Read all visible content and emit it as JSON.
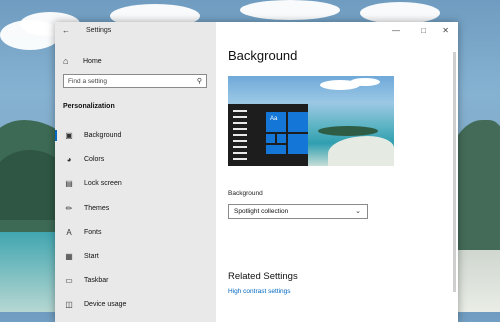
{
  "window": {
    "title": "Settings",
    "back_icon": "back-arrow-icon",
    "minimize_icon": "minimize-icon",
    "maximize_icon": "maximize-icon",
    "close_icon": "close-icon"
  },
  "sidebar": {
    "home": {
      "label": "Home",
      "icon": "home-icon"
    },
    "search": {
      "placeholder": "Find a setting",
      "icon": "search-icon"
    },
    "section_title": "Personalization",
    "items": [
      {
        "label": "Background",
        "icon": "picture-icon",
        "active": true
      },
      {
        "label": "Colors",
        "icon": "palette-icon",
        "active": false
      },
      {
        "label": "Lock screen",
        "icon": "lock-screen-icon",
        "active": false
      },
      {
        "label": "Themes",
        "icon": "brush-icon",
        "active": false
      },
      {
        "label": "Fonts",
        "icon": "fonts-icon",
        "active": false
      },
      {
        "label": "Start",
        "icon": "start-icon",
        "active": false
      },
      {
        "label": "Taskbar",
        "icon": "taskbar-icon",
        "active": false
      },
      {
        "label": "Device usage",
        "icon": "device-usage-icon",
        "active": false
      }
    ]
  },
  "main": {
    "title": "Background",
    "preview": {
      "tile_text": "Aa"
    },
    "background_label": "Background",
    "background_value": "Spotlight collection",
    "related_title": "Related Settings",
    "related_link": "High contrast settings"
  },
  "colors": {
    "accent": "#0067c0",
    "sidebar_bg": "#e9e9e9",
    "tile": "#1476d6"
  }
}
